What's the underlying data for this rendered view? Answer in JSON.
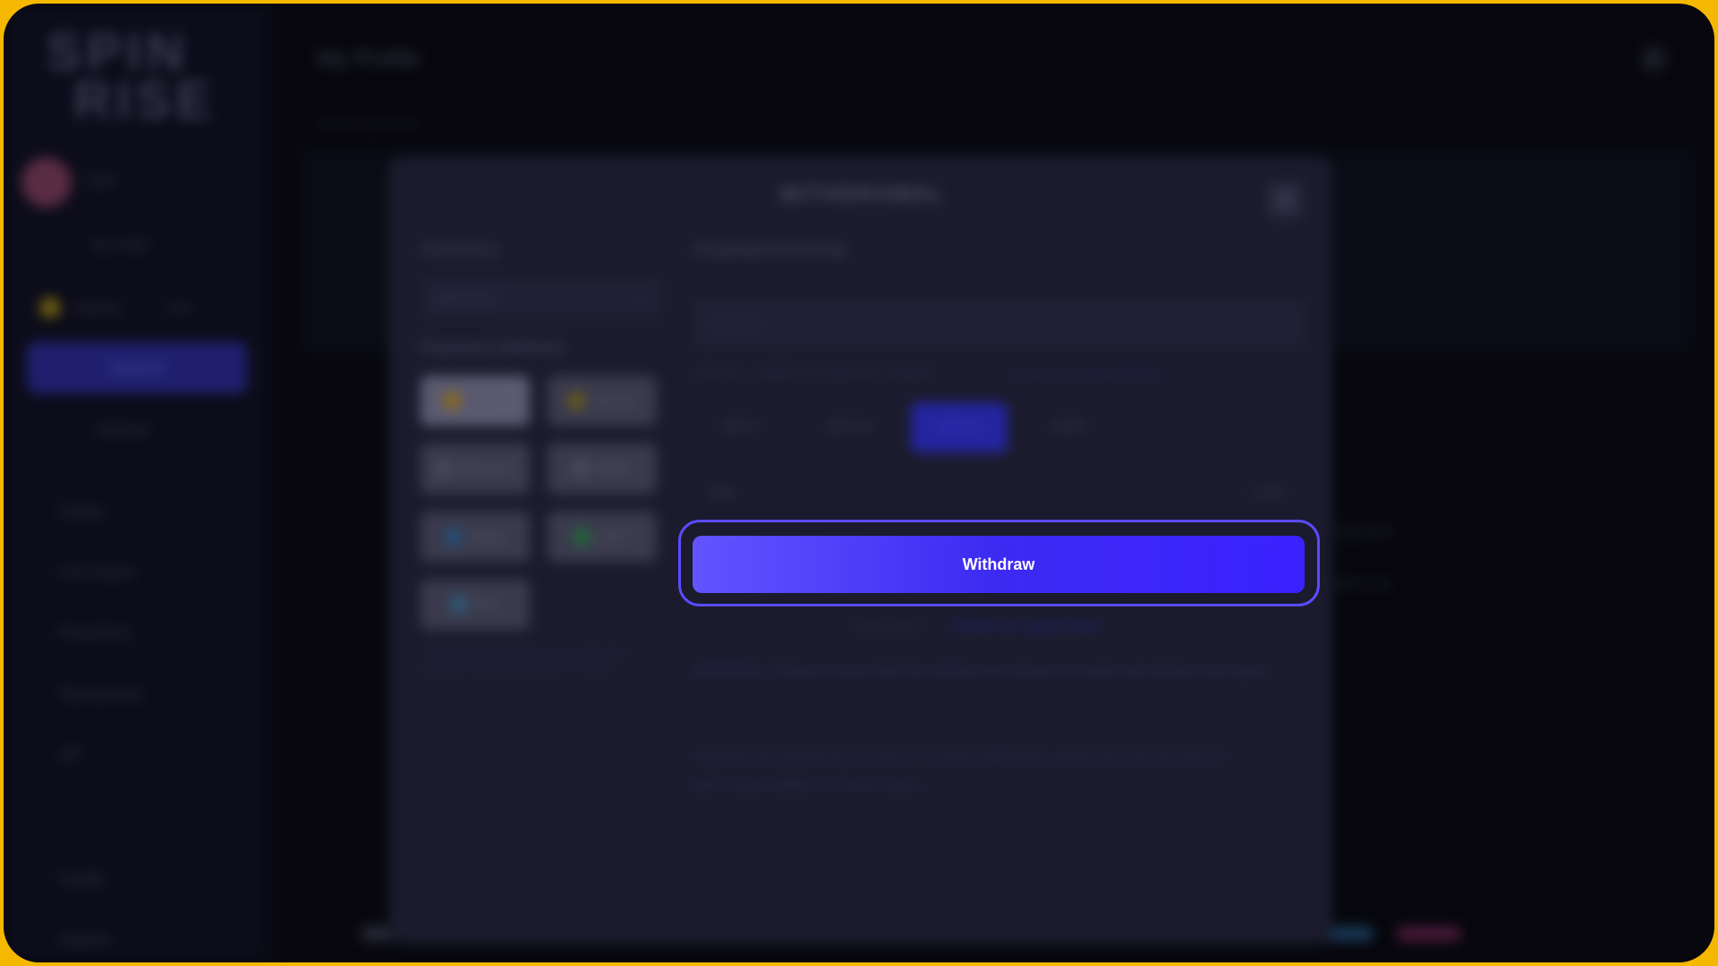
{
  "app": {
    "logo_line1": "SPIN",
    "logo_line2": "RISE",
    "page_title": "My Profile",
    "breadcrumb": "Home / My Profile"
  },
  "sidebar": {
    "username": "User",
    "profile_link": "My Profile",
    "balance_label": "Balance",
    "balance_value": "0.00",
    "active_item": "Deposit",
    "secondary_item": "Withdraw",
    "items": [
      "Casino",
      "Live Casino",
      "Promotions",
      "Tournaments",
      "VIP",
      "Loyalty",
      "Support"
    ]
  },
  "background": {
    "right_label": "Payment",
    "right_value": "Withdrawal"
  },
  "modal": {
    "title": "WITHDRAWAL",
    "close_icon": "close-icon",
    "currency_label": "Currency",
    "currency_value": "CRYPTO",
    "payment_method_label": "Payment Method",
    "payment_methods": [
      {
        "label": "Bitcoin",
        "color": "#8a6a1a",
        "selected": true
      },
      {
        "label": "Litecoin",
        "color": "#6a5a1a",
        "selected": false
      },
      {
        "label": "Ethereum",
        "color": "#4a4a5a",
        "selected": false
      },
      {
        "label": "Tether",
        "color": "#4a4a5a",
        "selected": false
      },
      {
        "label": "Ripple",
        "color": "#23507a",
        "selected": false
      },
      {
        "label": "USDT",
        "color": "#1f6a3a",
        "selected": false
      },
      {
        "label": "Tron",
        "color": "#2f5a7a",
        "selected": false
      }
    ],
    "method_note": "Your withdrawal will be processed to the selected crypto wallet within 24 hours",
    "processing_label": "Cryptoprocessing",
    "address_placeholder": "Address",
    "network_label": "Choose a wallet and payment network",
    "network_link": "Learn more about networks",
    "networks": [
      {
        "label": "BEP2",
        "selected": false
      },
      {
        "label": "BEP20",
        "selected": false
      },
      {
        "label": "ERC20",
        "selected": false
      },
      {
        "label": "OMNI",
        "selected": false
      }
    ],
    "amount_value": "100",
    "amount_suffix": "USD",
    "withdraw_button": "Withdraw",
    "help_prefix": "Need help?",
    "help_link": "Contact our support team",
    "warning_text": "WARNING: Please ensure that the address is entered correctly and without any typos.",
    "disclaimer_text": "Deposits processed by incorrect or invalid addresses will be lost and we will not take responsibility for these cases."
  },
  "colors": {
    "frame": "#f5b800",
    "accent": "#4a38ff"
  }
}
